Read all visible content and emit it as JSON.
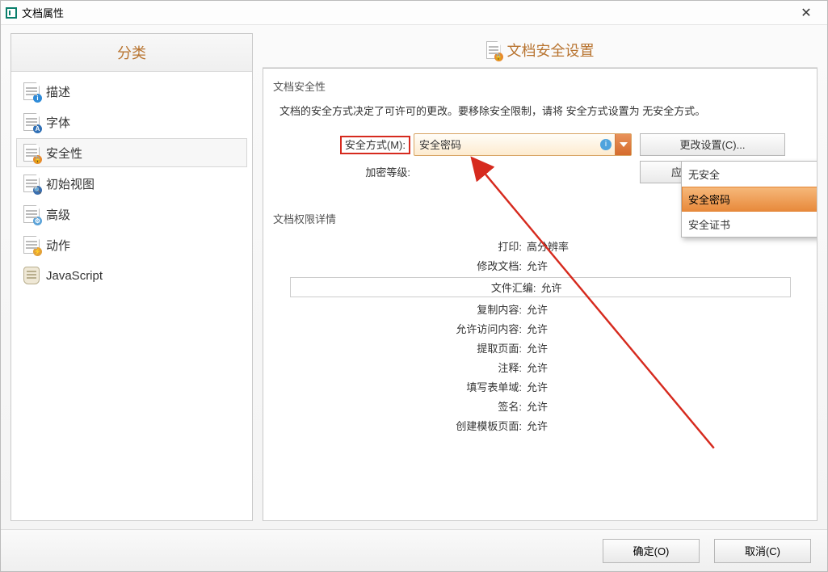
{
  "window": {
    "title": "文档属性"
  },
  "sidebar": {
    "header": "分类",
    "items": [
      {
        "label": "描述"
      },
      {
        "label": "字体"
      },
      {
        "label": "安全性"
      },
      {
        "label": "初始视图"
      },
      {
        "label": "高级"
      },
      {
        "label": "动作"
      },
      {
        "label": "JavaScript"
      }
    ],
    "selected_index": 2
  },
  "main": {
    "header": "文档安全设置",
    "security_section": {
      "title": "文档安全性",
      "description": "文档的安全方式决定了可许可的更改。要移除安全限制，请将 安全方式设置为 无安全方式。",
      "method_label": "安全方式(M):",
      "method_value": "安全密码",
      "level_label": "加密等级:",
      "change_settings_button": "更改设置(C)...",
      "apply_policy_button": "应用安全策略"
    },
    "dropdown": {
      "items": [
        "无安全",
        "安全密码",
        "安全证书"
      ],
      "hover_index": 1
    },
    "permissions_section": {
      "title": "文档权限详情",
      "rows": [
        {
          "label": "打印:",
          "value": "高分辨率"
        },
        {
          "label": "修改文档:",
          "value": "允许"
        },
        {
          "label": "文件汇编:",
          "value": "允许",
          "outlined": true
        },
        {
          "label": "复制内容:",
          "value": "允许"
        },
        {
          "label": "允许访问内容:",
          "value": "允许"
        },
        {
          "label": "提取页面:",
          "value": "允许"
        },
        {
          "label": "注释:",
          "value": "允许"
        },
        {
          "label": "填写表单域:",
          "value": "允许"
        },
        {
          "label": "签名:",
          "value": "允许"
        },
        {
          "label": "创建模板页面:",
          "value": "允许"
        }
      ]
    }
  },
  "footer": {
    "ok": "确定(O)",
    "cancel": "取消(C)"
  }
}
